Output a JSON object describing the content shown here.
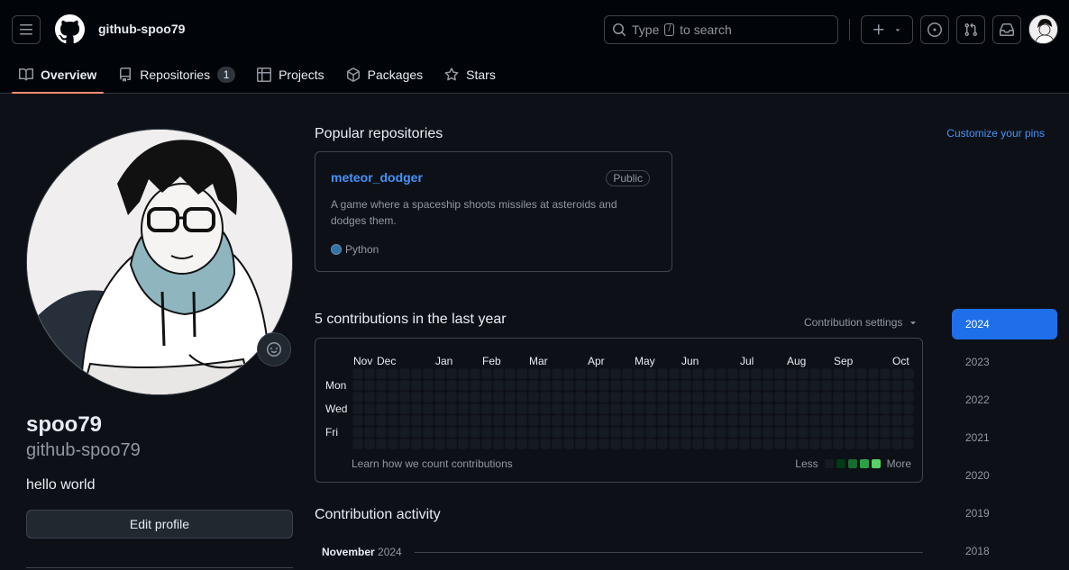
{
  "header": {
    "username": "github-spoo79",
    "search_prefix": "Type",
    "search_key": "/",
    "search_suffix": "to search"
  },
  "tabs": [
    {
      "label": "Overview",
      "selected": true
    },
    {
      "label": "Repositories",
      "count": "1"
    },
    {
      "label": "Projects"
    },
    {
      "label": "Packages"
    },
    {
      "label": "Stars"
    }
  ],
  "profile": {
    "name": "spoo79",
    "login": "github-spoo79",
    "bio": "hello world",
    "edit_label": "Edit profile"
  },
  "popular": {
    "title": "Popular repositories",
    "customize_label": "Customize your pins",
    "repo": {
      "name": "meteor_dodger",
      "visibility": "Public",
      "description": "A game where a spaceship shoots missiles at asteroids and dodges them.",
      "language": "Python",
      "language_color": "#3572a5"
    }
  },
  "contributions": {
    "title": "5 contributions in the last year",
    "settings_label": "Contribution settings",
    "months": [
      "Nov",
      "Dec",
      "Jan",
      "Feb",
      "Mar",
      "Apr",
      "May",
      "Jun",
      "Jul",
      "Aug",
      "Sep",
      "Oct"
    ],
    "days": [
      "Mon",
      "Wed",
      "Fri"
    ],
    "learn_label": "Learn how we count contributions",
    "less_label": "Less",
    "more_label": "More",
    "legend_colors": [
      "#151b23",
      "#033a16",
      "#196c2e",
      "#2ea043",
      "#56d364"
    ],
    "empty_color": "#151b23"
  },
  "years": [
    "2024",
    "2023",
    "2022",
    "2021",
    "2020",
    "2019",
    "2018"
  ],
  "activity": {
    "title": "Contribution activity",
    "month": "November",
    "year": "2024"
  }
}
